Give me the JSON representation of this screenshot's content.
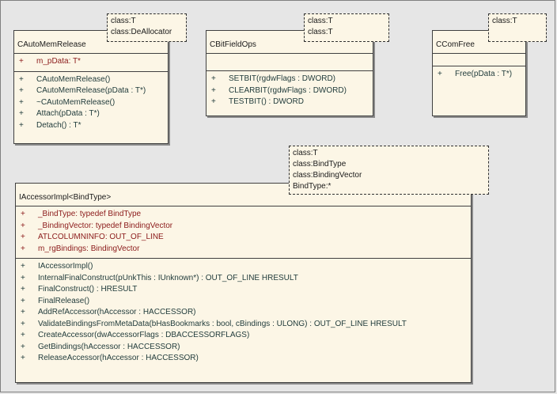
{
  "classes": {
    "cautomemrelease": {
      "name": "CAutoMemRelease",
      "template": [
        "class:T",
        "class:DeAllocator"
      ],
      "attributes": [
        {
          "vis": "+",
          "text": "m_pData:  T*"
        }
      ],
      "operations": [
        {
          "vis": "+",
          "text": "CAutoMemRelease()"
        },
        {
          "vis": "+",
          "text": "CAutoMemRelease(pData : T*)"
        },
        {
          "vis": "+",
          "text": "~CAutoMemRelease()"
        },
        {
          "vis": "+",
          "text": "Attach(pData : T*)"
        },
        {
          "vis": "+",
          "text": "Detach() : T*"
        }
      ]
    },
    "cbitfieldops": {
      "name": "CBitFieldOps",
      "template": [
        "class:T",
        "class:T"
      ],
      "attributes": [],
      "operations": [
        {
          "vis": "+",
          "text": "SETBIT(rgdwFlags : DWORD)"
        },
        {
          "vis": "+",
          "text": "CLEARBIT(rgdwFlags : DWORD)"
        },
        {
          "vis": "+",
          "text": "TESTBIT() : DWORD"
        }
      ]
    },
    "ccomfree": {
      "name": "CComFree",
      "template": [
        "class:T"
      ],
      "attributes": [],
      "operations": [
        {
          "vis": "+",
          "text": "Free(pData : T*)"
        }
      ]
    },
    "iaccessorimpl": {
      "name": "IAccessorImpl<BindType>",
      "template": [
        "class:T",
        "class:BindType",
        "class:BindingVector",
        "BindType:*"
      ],
      "attributes": [
        {
          "vis": "+",
          "text": "_BindType:  typedef BindType"
        },
        {
          "vis": "+",
          "text": "_BindingVector:  typedef BindingVector"
        },
        {
          "vis": "+",
          "text": "ATLCOLUMNINFO:  OUT_OF_LINE"
        },
        {
          "vis": "+",
          "text": "m_rgBindings:  BindingVector"
        }
      ],
      "operations": [
        {
          "vis": "+",
          "text": "IAccessorImpl()"
        },
        {
          "vis": "+",
          "text": "InternalFinalConstruct(pUnkThis : IUnknown*) : OUT_OF_LINE HRESULT"
        },
        {
          "vis": "+",
          "text": "FinalConstruct() : HRESULT"
        },
        {
          "vis": "+",
          "text": "FinalRelease()"
        },
        {
          "vis": "+",
          "text": "AddRefAccessor(hAccessor : HACCESSOR)"
        },
        {
          "vis": "+",
          "text": "ValidateBindingsFromMetaData(bHasBookmarks : bool, cBindings : ULONG) : OUT_OF_LINE HRESULT"
        },
        {
          "vis": "+",
          "text": "CreateAccessor(dwAccessorFlags : DBACCESSORFLAGS)"
        },
        {
          "vis": "+",
          "text": "GetBindings(hAccessor : HACCESSOR)"
        },
        {
          "vis": "+",
          "text": "ReleaseAccessor(hAccessor : HACCESSOR)"
        }
      ]
    }
  }
}
